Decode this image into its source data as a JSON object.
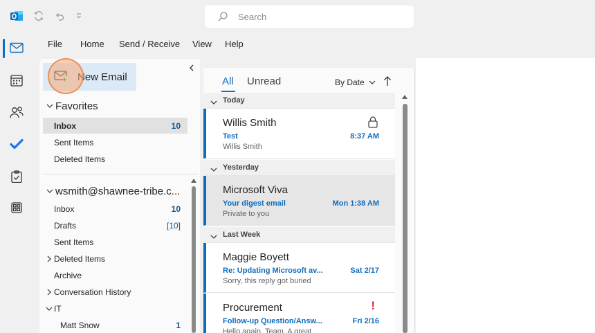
{
  "titlebar": {
    "search_placeholder": "Search"
  },
  "menubar": {
    "items": [
      "File",
      "Home",
      "Send / Receive",
      "View",
      "Help"
    ]
  },
  "rail": {
    "items": [
      "mail-icon",
      "calendar-icon",
      "people-icon",
      "todo-icon",
      "tasks-icon",
      "apps-icon"
    ]
  },
  "folderpane": {
    "new_email": "New Email",
    "favorites_label": "Favorites",
    "favorites": [
      {
        "name": "Inbox",
        "count": "10"
      },
      {
        "name": "Sent Items",
        "count": ""
      },
      {
        "name": "Deleted Items",
        "count": ""
      }
    ],
    "account_label": "wsmith@shawnee-tribe.c...",
    "folders": [
      {
        "name": "Inbox",
        "count": "10"
      },
      {
        "name": "Drafts",
        "count": "[10]"
      },
      {
        "name": "Sent Items",
        "count": ""
      },
      {
        "name": "Deleted Items",
        "count": ""
      },
      {
        "name": "Archive",
        "count": ""
      },
      {
        "name": "Conversation History",
        "count": ""
      },
      {
        "name": "IT",
        "count": ""
      },
      {
        "name": "Matt Snow",
        "count": "1"
      }
    ]
  },
  "msglist": {
    "tab_all": "All",
    "tab_unread": "Unread",
    "sort_label": "By Date",
    "groups": [
      "Today",
      "Yesterday",
      "Last Week"
    ],
    "messages": [
      {
        "sender": "Willis Smith",
        "subject": "Test",
        "time": "8:37 AM",
        "preview": "Willis Smith"
      },
      {
        "sender": "Microsoft Viva",
        "subject": "Your digest email",
        "time": "Mon 1:38 AM",
        "preview": "Private to you"
      },
      {
        "sender": "Maggie Boyett",
        "subject": "Re: Updating Microsoft av...",
        "time": "Sat 2/17",
        "preview": "Sorry, this reply got buried"
      },
      {
        "sender": "Procurement",
        "subject": "Follow-up Question/Answ...",
        "time": "Fri 2/16",
        "preview": "Hello again, Team.  A great",
        "importance": "!"
      }
    ]
  },
  "colors": {
    "accent": "#0f6cbd",
    "new_email_bg": "#dce9f7",
    "important": "#d13438"
  }
}
